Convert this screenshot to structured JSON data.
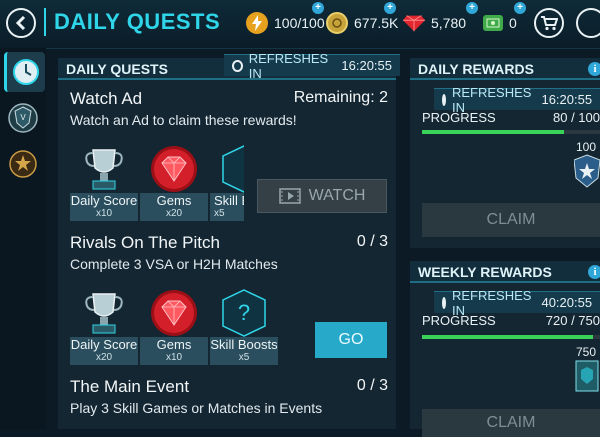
{
  "header": {
    "title": "DAILY QUESTS",
    "energy": "100/100",
    "coins": "677.5K",
    "gems": "5,780",
    "cash": "0"
  },
  "quests_panel": {
    "title": "DAILY QUESTS",
    "refreshes_label": "REFRESHES IN",
    "refreshes_time": "16:20:55",
    "quests": [
      {
        "title": "Watch Ad",
        "status": "Remaining: 2",
        "description": "Watch an Ad to claim these rewards!",
        "rewards": [
          {
            "name": "Daily Score",
            "count": "x10"
          },
          {
            "name": "Gems",
            "count": "x20"
          },
          {
            "name": "Skill B",
            "count": "x5"
          }
        ],
        "action": "WATCH"
      },
      {
        "title": "Rivals On The Pitch",
        "status": "0 / 3",
        "description": "Complete 3 VSA or H2H Matches",
        "rewards": [
          {
            "name": "Daily Score",
            "count": "x20"
          },
          {
            "name": "Gems",
            "count": "x10"
          },
          {
            "name": "Skill Boosts",
            "count": "x5"
          }
        ],
        "action": "GO"
      },
      {
        "title": "The Main Event",
        "status": "0 / 3",
        "description": "Play 3 Skill Games or Matches in Events"
      }
    ]
  },
  "daily_rewards": {
    "title": "DAILY REWARDS",
    "refreshes_label": "REFRESHES IN",
    "refreshes_time": "16:20:55",
    "progress_label": "PROGRESS",
    "progress_value": "80 / 100",
    "progress_fraction": 0.8,
    "milestone": "100",
    "claim_label": "CLAIM"
  },
  "weekly_rewards": {
    "title": "WEEKLY REWARDS",
    "refreshes_label": "REFRESHES IN",
    "refreshes_time": "40:20:55",
    "progress_label": "PROGRESS",
    "progress_value": "720 / 750",
    "progress_fraction": 0.96,
    "milestone": "750",
    "claim_label": "CLAIM"
  },
  "colors": {
    "accent": "#2fd5e8",
    "go_button": "#27a9c9",
    "progress_fill": "#39d35a",
    "gem_red": "#e0262f"
  },
  "icons": [
    "back-arrow-icon",
    "energy-bolt-icon",
    "coin-icon",
    "gem-icon",
    "cash-icon",
    "store-cart-icon",
    "clock-icon",
    "trophy-icon",
    "shield-icon",
    "skill-boost-icon",
    "video-icon",
    "info-icon"
  ]
}
